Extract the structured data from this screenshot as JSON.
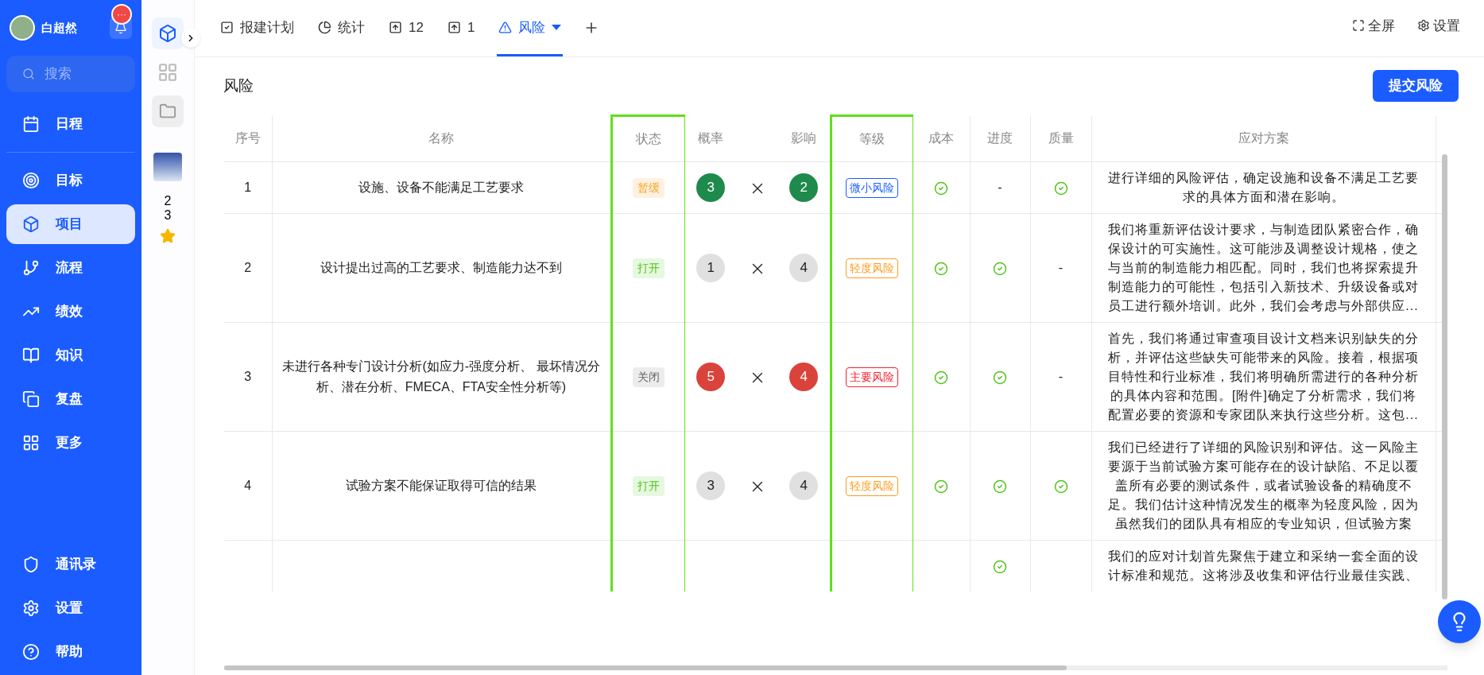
{
  "user": {
    "name": "白超然",
    "badge": "···"
  },
  "search": {
    "placeholder": "搜索"
  },
  "nav": [
    {
      "label": "日程",
      "selected": false
    },
    {
      "label": "目标",
      "selected": false
    },
    {
      "label": "项目",
      "selected": true
    },
    {
      "label": "流程",
      "selected": false
    },
    {
      "label": "绩效",
      "selected": false
    },
    {
      "label": "知识",
      "selected": false
    },
    {
      "label": "复盘",
      "selected": false
    },
    {
      "label": "更多",
      "selected": false
    }
  ],
  "nav_bottom": [
    {
      "label": "通讯录"
    },
    {
      "label": "设置"
    },
    {
      "label": "帮助"
    }
  ],
  "rail": {
    "count": "23"
  },
  "tabs": [
    {
      "label": "报建计划",
      "selected": false
    },
    {
      "label": "统计",
      "selected": false
    },
    {
      "label": "12",
      "selected": false
    },
    {
      "label": "1",
      "selected": false
    },
    {
      "label": "风险",
      "selected": true
    }
  ],
  "toolbar": [
    "全屏",
    "设置"
  ],
  "page": {
    "title": "风险",
    "submit": "提交风险"
  },
  "table": {
    "columns": [
      "序号",
      "名称",
      "状态",
      "概率",
      "影响",
      "等级",
      "成本",
      "进度",
      "质量",
      "应对方案"
    ],
    "rows": [
      {
        "index": "1",
        "name": "设施、设备不能满足工艺要求",
        "status": {
          "label": "暂缓",
          "kind": "paused"
        },
        "probability": {
          "value": "3",
          "color": "#1e8a4c"
        },
        "impact": {
          "value": "2",
          "color": "#1e8a4c"
        },
        "grade": {
          "label": "微小风险",
          "kind": "minor"
        },
        "cost": {
          "kind": "check"
        },
        "progress": {
          "kind": "dash",
          "text": "-"
        },
        "quality": {
          "kind": "check"
        },
        "plan": "进行详细的风险评估，确定设施和设备不满足工艺要求的具体方面和潜在影响。"
      },
      {
        "index": "2",
        "name": "设计提出过高的工艺要求、制造能力达不到",
        "status": {
          "label": "打开",
          "kind": "open"
        },
        "probability": {
          "value": "1",
          "color": "#e0e0e0"
        },
        "impact": {
          "value": "4",
          "color": "#e0e0e0"
        },
        "grade": {
          "label": "轻度风险",
          "kind": "light"
        },
        "cost": {
          "kind": "check"
        },
        "progress": {
          "kind": "check"
        },
        "quality": {
          "kind": "dash",
          "text": "-"
        },
        "plan": "我们将重新评估设计要求，与制造团队紧密合作，确保设计的可实施性。这可能涉及调整设计规格，使之与当前的制造能力相匹配。同时，我们也将探索提升制造能力的可能性，包括引入新技术、升级设备或对员工进行额外培训。此外，我们会考虑与外部供应..."
      },
      {
        "index": "3",
        "name": "未进行各种专门设计分析(如应力-强度分析、 最坏情况分析、潜在分析、FMECA、FTA安全性分析等)",
        "status": {
          "label": "关闭",
          "kind": "closed"
        },
        "probability": {
          "value": "5",
          "color": "#d9433b"
        },
        "impact": {
          "value": "4",
          "color": "#d9433b"
        },
        "grade": {
          "label": "主要风险",
          "kind": "major"
        },
        "cost": {
          "kind": "check"
        },
        "progress": {
          "kind": "check"
        },
        "quality": {
          "kind": "dash",
          "text": "-"
        },
        "plan": "首先，我们将通过审查项目设计文档来识别缺失的分析，并评估这些缺失可能带来的风险。接着，根据项目特性和行业标准，我们将明确所需进行的各种分析的具体内容和范围。[附件]确定了分析需求，我们将配置必要的资源和专家团队来执行这些分析。这包..."
      },
      {
        "index": "4",
        "name": "试验方案不能保证取得可信的结果",
        "status": {
          "label": "打开",
          "kind": "open"
        },
        "probability": {
          "value": "3",
          "color": "#e0e0e0"
        },
        "impact": {
          "value": "4",
          "color": "#e0e0e0"
        },
        "grade": {
          "label": "轻度风险",
          "kind": "light"
        },
        "cost": {
          "kind": "check"
        },
        "progress": {
          "kind": "check"
        },
        "quality": {
          "kind": "check"
        },
        "plan": "我们已经进行了详细的风险识别和评估。这一风险主要源于当前试验方案可能存在的设计缺陷、不足以覆盖所有必要的测试条件，或者试验设备的精确度不足。我们估计这种情况发生的概率为轻度风险，因为虽然我们的团队具有相应的专业知识，但试验方案"
      },
      {
        "progress": {
          "kind": "check"
        },
        "plan": "我们的应对计划首先聚焦于建立和采纳一套全面的设计标准和规范。这将涉及收集和评估行业最佳实践、"
      }
    ]
  }
}
